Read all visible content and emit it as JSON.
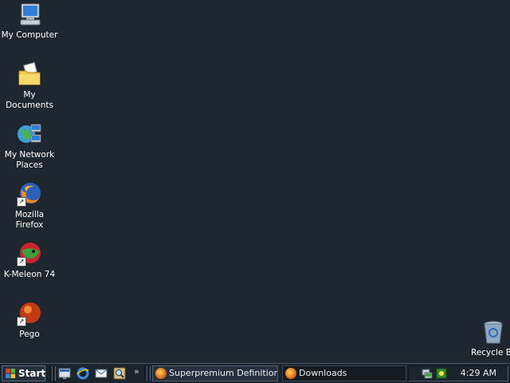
{
  "desktop": {
    "icons": [
      {
        "label": "My Computer",
        "icon": "my-computer-icon"
      },
      {
        "label": "My Documents",
        "icon": "my-documents-icon"
      },
      {
        "label": "My Network Places",
        "icon": "network-places-icon"
      },
      {
        "label": "Mozilla Firefox",
        "icon": "firefox-icon"
      },
      {
        "label": "K-Meleon 74",
        "icon": "k-meleon-icon"
      },
      {
        "label": "Pego",
        "icon": "pego-icon"
      }
    ],
    "recycle_bin": {
      "label": "Recycle Bi",
      "icon": "recycle-bin-icon"
    }
  },
  "taskbar": {
    "start_label": "Start",
    "quicklaunch": [
      "show-desktop-icon",
      "internet-explorer-icon",
      "outlook-icon",
      "search-icon"
    ],
    "more_label": "»",
    "tasks": [
      {
        "label": "Superpremium Definition ...",
        "icon": "firefox-icon",
        "active": false
      },
      {
        "label": "Downloads",
        "icon": "firefox-icon",
        "active": true
      }
    ],
    "tray": {
      "icons": [
        "network-tray-icon",
        "antivirus-tray-icon"
      ],
      "clock": "4:29 AM"
    }
  },
  "colors": {
    "desktop_bg": "#1e2630",
    "taskbar_bg": "#1b232d"
  }
}
